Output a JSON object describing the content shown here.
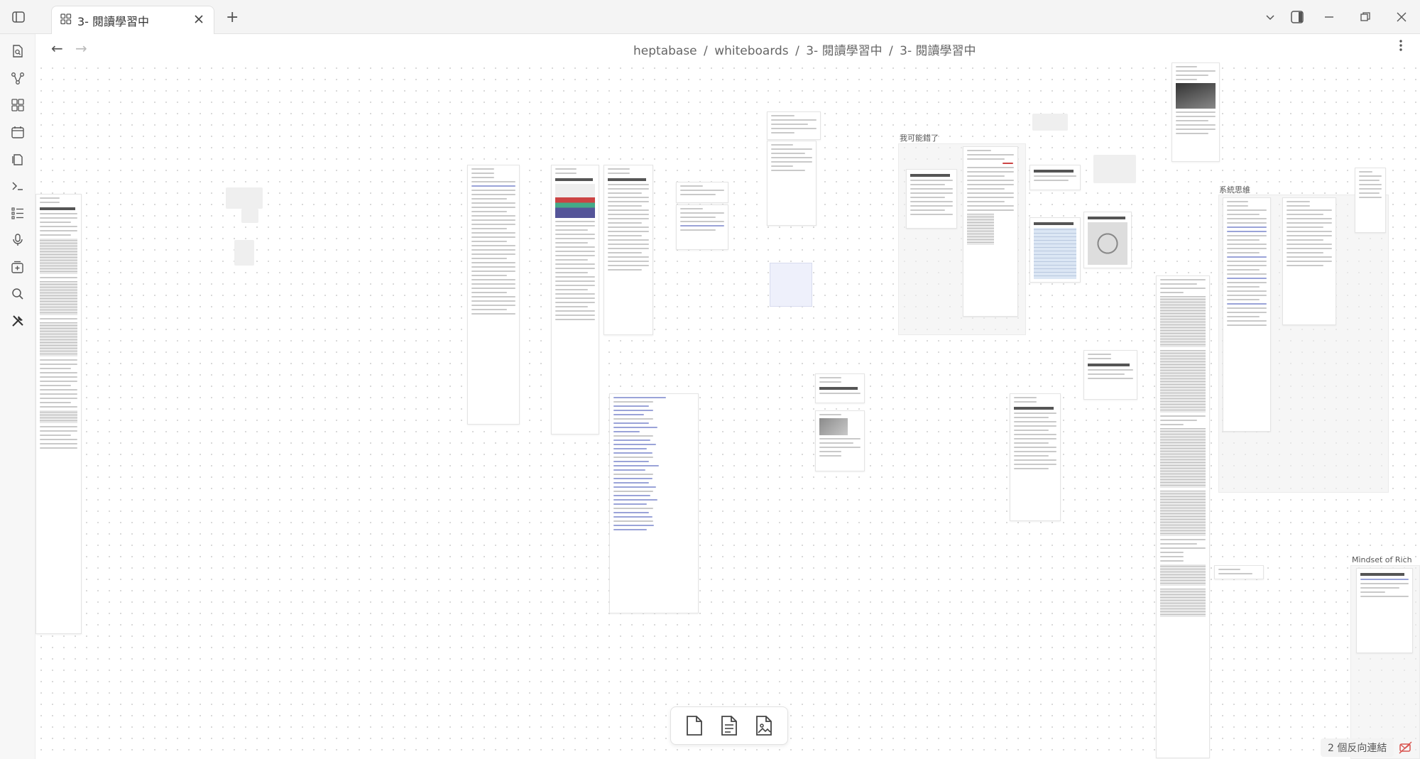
{
  "window": {
    "tab_label": "3- 閱讀學習中",
    "new_tab": "+"
  },
  "nav": {
    "back": "←",
    "forward": "→",
    "breadcrumb": [
      "heptabase",
      "whiteboards",
      "3- 閱讀學習中",
      "3- 閱讀學習中"
    ],
    "separator": "/"
  },
  "canvas": {
    "section_labels": {
      "what_i_did": "我可能錯了",
      "systems_thinking": "系統思維",
      "mindset_of_rich": "Mindset of Rich"
    }
  },
  "status": {
    "backlinks": "2 個反向連結"
  },
  "icons": {
    "sidebar_toggle": "sidebar-toggle-icon",
    "whiteboard": "whiteboard-icon",
    "close": "close-icon",
    "new_tab": "plus-icon",
    "chevron": "chevron-down-icon",
    "split": "split-view-icon",
    "minimize": "minimize-icon",
    "restore": "restore-icon",
    "window_close": "window-close-icon",
    "more": "more-vertical-icon",
    "settings": "gear-icon",
    "zoom_in": "zoom-in-icon",
    "refresh": "refresh-icon",
    "fit": "fit-screen-icon",
    "zoom_out": "zoom-out-icon",
    "undo": "undo-icon",
    "redo": "redo-icon",
    "help": "help-icon"
  },
  "colors": {
    "accent_link": "#4b55c8",
    "warning": "#d9534f"
  }
}
